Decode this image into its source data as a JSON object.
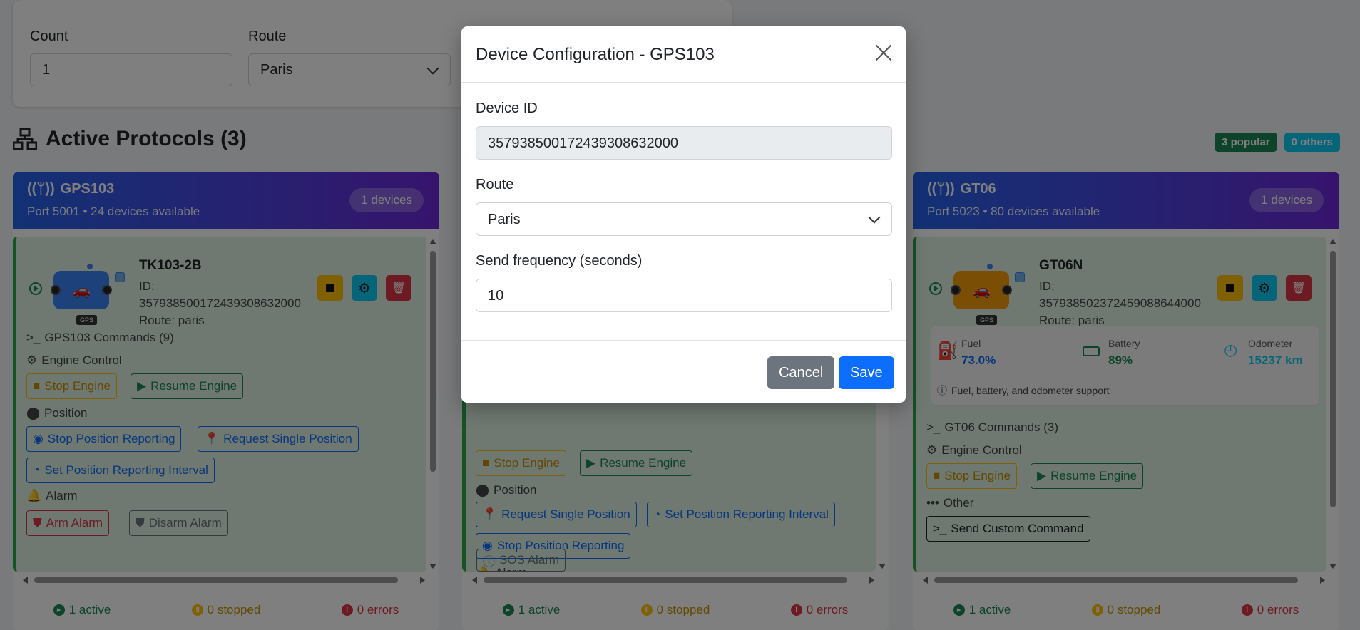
{
  "filters": {
    "count_label": "Count",
    "count_value": "1",
    "route_label": "Route",
    "route_value": "Paris"
  },
  "section": {
    "title": "Active Protocols (3)",
    "popular_badge": "3 popular",
    "others_badge": "0 others"
  },
  "protocols": [
    {
      "name": "GPS103",
      "sub": "Port 5001 • 24 devices available",
      "devices": "1 devices",
      "device": {
        "name": "TK103-2B",
        "id_label": "ID:",
        "id": "35793850017243930863200​0",
        "route": "Route: paris",
        "tag": "GPS"
      },
      "commands_title": "GPS103 Commands (9)",
      "engine_label": "Engine Control",
      "stop_engine": "Stop Engine",
      "resume_engine": "Resume Engine",
      "position_label": "Position",
      "stop_position": "Stop Position Reporting",
      "request_single": "Request Single Position",
      "set_interval": "Set Position Reporting Interval",
      "alarm_label": "Alarm",
      "arm_alarm": "Arm Alarm",
      "disarm_alarm": "Disarm Alarm",
      "active": "1 active",
      "stopped": "0 stopped",
      "errors": "0 errors"
    },
    {
      "stop_engine": "Stop Engine",
      "resume_engine": "Resume Engine",
      "position_label": "Position",
      "request_single": "Request Single Position",
      "set_interval": "Set Position Reporting Interval",
      "stop_position": "Stop Position Reporting",
      "alarm_label": "Alarm",
      "sos_alarm": "SOS Alarm",
      "active": "1 active",
      "stopped": "0 stopped",
      "errors": "0 errors"
    },
    {
      "name": "GT06",
      "sub": "Port 5023 • 80 devices available",
      "devices": "1 devices",
      "device": {
        "name": "GT06N",
        "id_label": "ID:",
        "id": "357938502372459088644000",
        "route": "Route: paris",
        "tag": "GPS"
      },
      "fuel_label": "Fuel",
      "fuel_value": "73.0%",
      "battery_label": "Battery",
      "battery_value": "89%",
      "odometer_label": "Odometer",
      "odometer_value": "15237 km",
      "support_note": "Fuel, battery, and odometer support",
      "commands_title": "GT06 Commands (3)",
      "engine_label": "Engine Control",
      "stop_engine": "Stop Engine",
      "resume_engine": "Resume Engine",
      "other_label": "Other",
      "custom_command": "Send Custom Command",
      "active": "1 active",
      "stopped": "0 stopped",
      "errors": "0 errors"
    }
  ],
  "modal": {
    "title": "Device Configuration - GPS103",
    "device_id_label": "Device ID",
    "device_id_value": "357938500172439308632000",
    "route_label": "Route",
    "route_value": "Paris",
    "freq_label": "Send frequency (seconds)",
    "freq_value": "10",
    "cancel": "Cancel",
    "save": "Save"
  },
  "colors": {
    "primary": "#0d6efd",
    "secondary": "#6c757d",
    "success": "#198754",
    "warning": "#ffc107",
    "danger": "#dc3545",
    "info": "#0dcaf0"
  }
}
